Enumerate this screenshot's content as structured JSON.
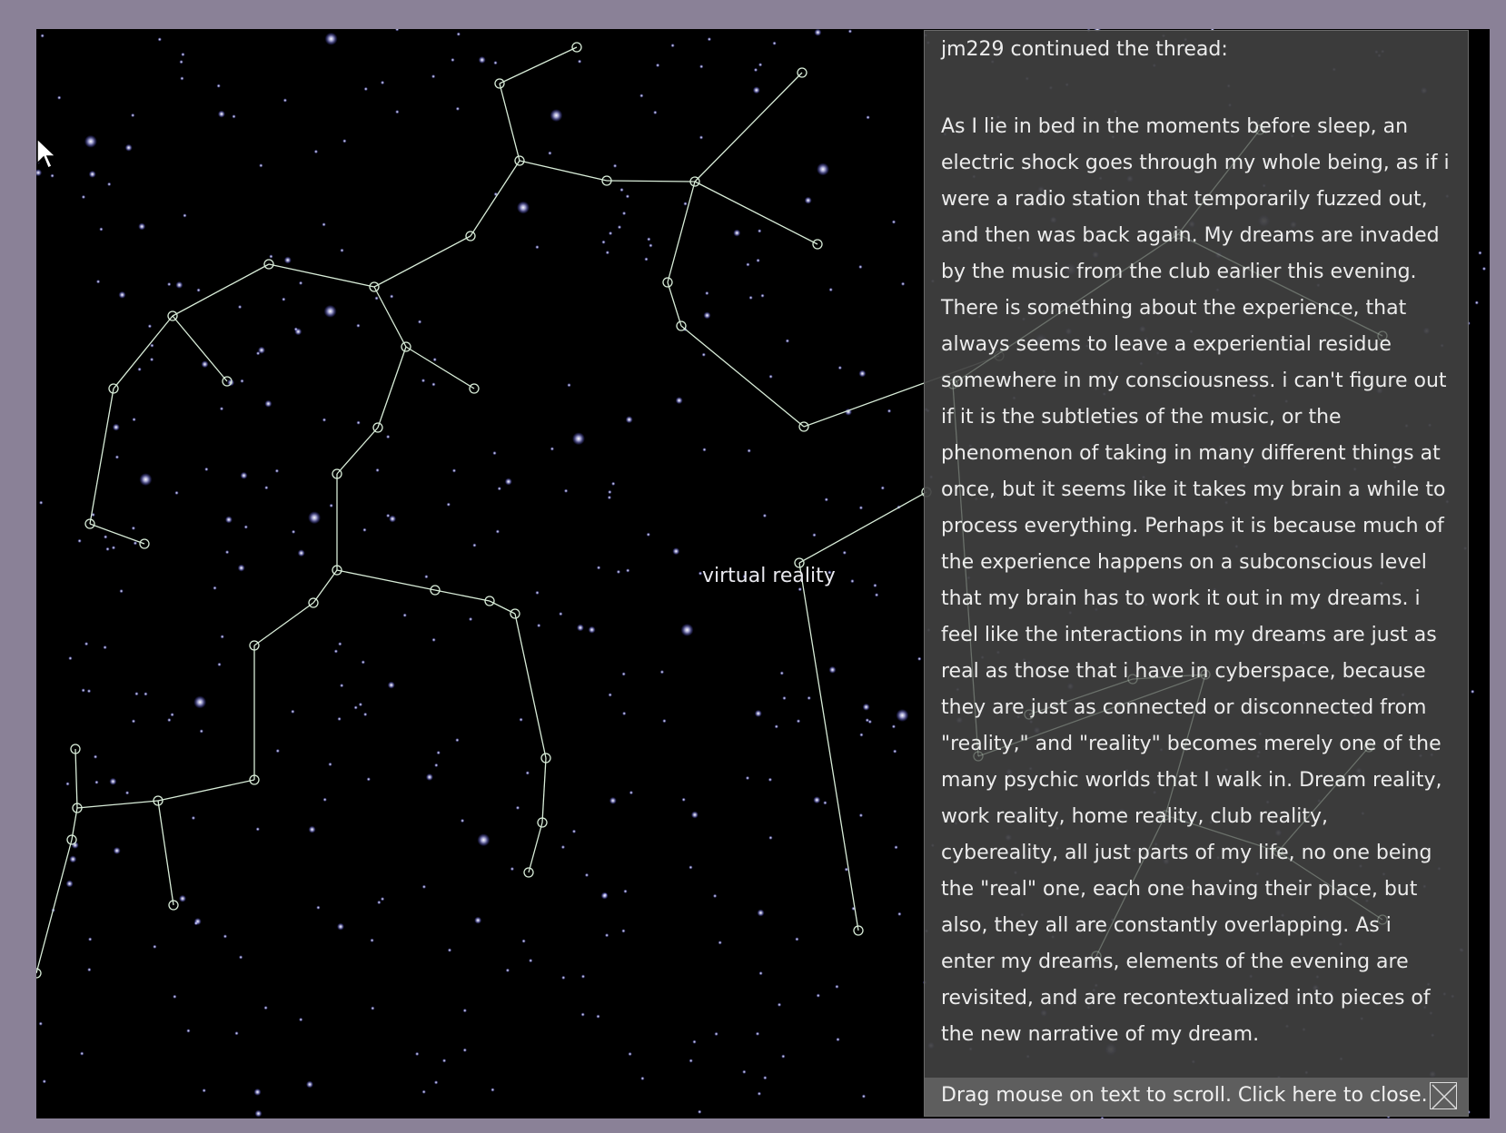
{
  "window": {
    "background_color": "#8a8197",
    "sky_color": "#000000",
    "line_color": "#d8ecd8"
  },
  "canvas": {
    "star_label": "virtual reality",
    "cursor_icon": "arrow-cursor-icon"
  },
  "thread_panel": {
    "header": "jm229 continued the thread:",
    "body": "As I lie in bed in the moments before sleep, an electric shock goes through my whole being, as if i were a radio station that temporarily fuzzed out, and then was back again. My dreams are invaded by the music from the club earlier this evening. There is something about the experience, that always seems to leave a experiential residue somewhere in my consciousness. i can't figure out if it is the subtleties of the music, or the phenomenon of taking in many different things at once, but it seems like it takes my brain a while to process everything. Perhaps it is because much of the experience happens on a subconscious level that my brain has to work it out in my dreams. i feel like the interactions in my dreams are just as real as those that i have in cyberspace, because they are just as connected or disconnected from \"reality,\" and \"reality\" becomes merely one of the many psychic worlds that I walk in. Dream reality, work reality, home reality, club reality, cybereality, all just parts of my life, no one being the \"real\" one, each one having their place, but also, they all are constantly overlapping. As i enter my dreams, elements of the evening are revisited, and are recontextualized into pieces of the new narrative of my dream.",
    "footer": "Drag mouse on text to scroll. Click here to close.",
    "close_icon": "close-x-icon",
    "panel_color": "#404040",
    "footer_color": "#5e5e5e"
  }
}
